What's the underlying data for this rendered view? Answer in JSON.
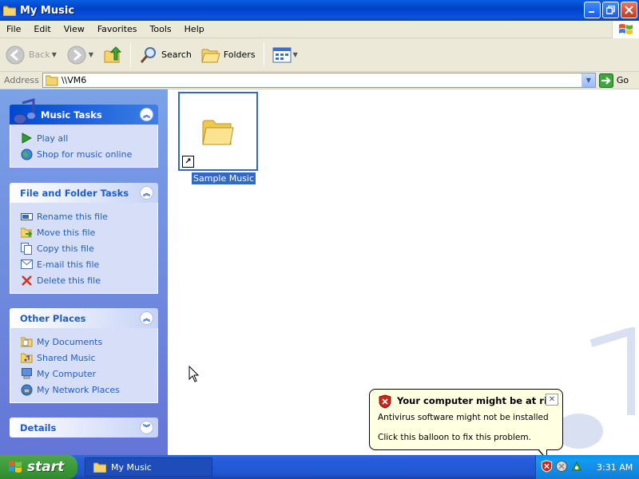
{
  "window": {
    "title": "My Music",
    "controls": [
      "minimize",
      "maximize",
      "close"
    ]
  },
  "menu": [
    "File",
    "Edit",
    "View",
    "Favorites",
    "Tools",
    "Help"
  ],
  "toolbar": {
    "back": "Back",
    "search": "Search",
    "folders": "Folders"
  },
  "address": {
    "label": "Address",
    "value": "\\\\VM6",
    "go": "Go"
  },
  "panels": {
    "music": {
      "title": "Music Tasks",
      "items": [
        "Play all",
        "Shop for music online"
      ]
    },
    "file": {
      "title": "File and Folder Tasks",
      "items": [
        "Rename this file",
        "Move this file",
        "Copy this file",
        "E-mail this file",
        "Delete this file"
      ]
    },
    "places": {
      "title": "Other Places",
      "items": [
        "My Documents",
        "Shared Music",
        "My Computer",
        "My Network Places"
      ]
    },
    "details": {
      "title": "Details"
    }
  },
  "content": {
    "item": "Sample Music"
  },
  "balloon": {
    "title": "Your computer might be at risk",
    "line1": "Antivirus software might not be installed",
    "line2": "Click this balloon to fix this problem."
  },
  "taskbar": {
    "start": "start",
    "task": "My Music",
    "clock": "3:31 AM"
  },
  "colors": {
    "titlebar": "#0a52dd",
    "taskbar": "#245edb",
    "start": "#3c9b3a",
    "link": "#215dc6",
    "selection": "#316ac5"
  }
}
